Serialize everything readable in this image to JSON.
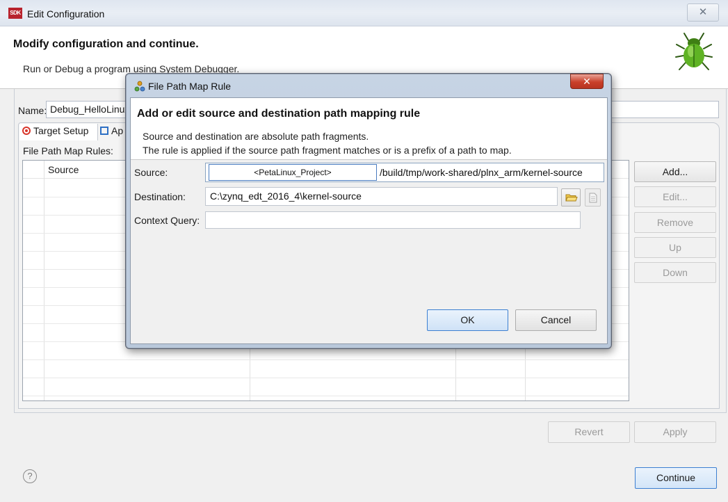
{
  "window": {
    "title": "Edit Configuration",
    "app_icon_text": "SDK",
    "close_glyph": "✕",
    "header_title": "Modify configuration and continue.",
    "header_subtitle": "Run or Debug a program using System Debugger.",
    "header_icon": "bug-icon"
  },
  "config": {
    "name_label": "Name:",
    "name_value": "Debug_HelloLinux",
    "tabs": [
      {
        "label": "Target Setup",
        "icon": "target-icon"
      },
      {
        "label": "Ap",
        "icon": "application-icon"
      }
    ],
    "rules_label": "File Path Map Rules:",
    "rules_table": {
      "columns": [
        "Source"
      ],
      "rows": []
    },
    "side_buttons": {
      "add": "Add...",
      "edit": "Edit...",
      "remove": "Remove",
      "up": "Up",
      "down": "Down"
    },
    "revert": "Revert",
    "apply": "Apply",
    "continue": "Continue",
    "help_glyph": "?"
  },
  "dialog": {
    "title": "File Path Map Rule",
    "close_glyph": "✕",
    "heading": "Add or edit source and destination path mapping rule",
    "description_line1": "Source and destination are absolute path fragments.",
    "description_line2": "The rule is applied if the source path fragment matches or is a prefix of a path to map.",
    "source_label": "Source:",
    "source_placeholder_overlay": "<PetaLinux_Project>",
    "source_suffix": "/build/tmp/work-shared/plnx_arm/kernel-source",
    "destination_label": "Destination:",
    "destination_value": "C:\\zynq_edt_2016_4\\kernel-source",
    "context_label": "Context Query:",
    "context_value": "",
    "ok": "OK",
    "cancel": "Cancel"
  }
}
